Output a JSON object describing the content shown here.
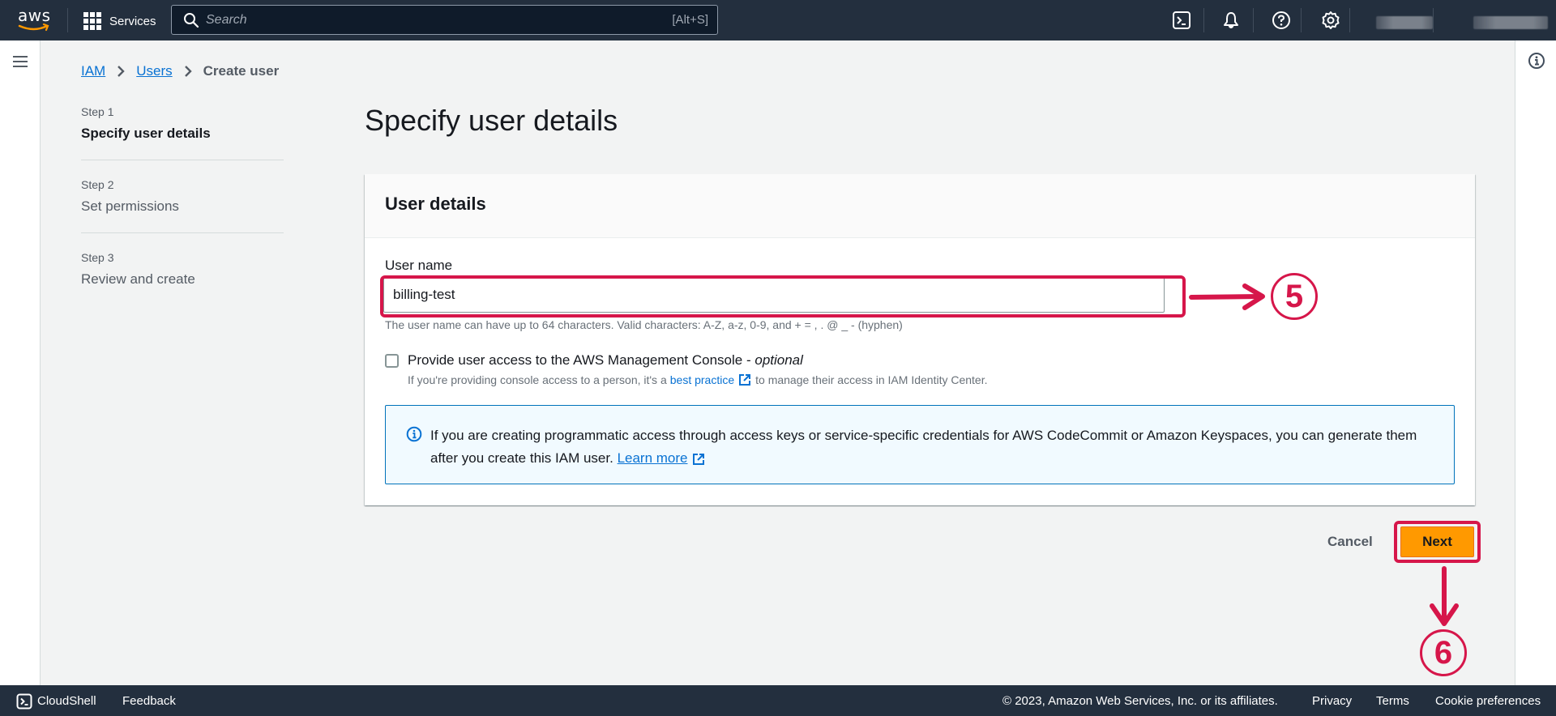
{
  "topbar": {
    "logo_text": "aws",
    "services_label": "Services",
    "search_placeholder": "Search",
    "search_shortcut": "[Alt+S]",
    "icons": [
      "cloudshell-icon",
      "bell-icon",
      "help-icon",
      "gear-icon"
    ]
  },
  "breadcrumb": {
    "items": [
      {
        "label": "IAM"
      },
      {
        "label": "Users"
      },
      {
        "label": "Create user"
      }
    ]
  },
  "steps": [
    {
      "number": "Step 1",
      "title": "Specify user details",
      "active": true
    },
    {
      "number": "Step 2",
      "title": "Set permissions",
      "active": false
    },
    {
      "number": "Step 3",
      "title": "Review and create",
      "active": false
    }
  ],
  "page_title": "Specify user details",
  "panel": {
    "header": "User details",
    "user_name_label": "User name",
    "user_name_value": "billing-test",
    "user_name_hint": "The user name can have up to 64 characters. Valid characters: A-Z, a-z, 0-9, and + = , . @ _ - (hyphen)",
    "console_access": {
      "label": "Provide user access to the AWS Management Console - ",
      "label_optional": "optional",
      "checked": false,
      "desc_before": "If you're providing console access to a person, it's a",
      "desc_link": "best practice",
      "desc_after": "to manage their access in IAM Identity Center."
    },
    "info_alert": {
      "text": "If you are creating programmatic access through access keys or service-specific credentials for AWS CodeCommit or Amazon Keyspaces, you can generate them after you create this IAM user.",
      "link": "Learn more"
    }
  },
  "actions": {
    "cancel": "Cancel",
    "next": "Next"
  },
  "annotations": {
    "step5": "5",
    "step6": "6",
    "color": "#d6164a"
  },
  "footer": {
    "cloudshell": "CloudShell",
    "feedback": "Feedback",
    "copyright": "© 2023, Amazon Web Services, Inc. or its affiliates.",
    "privacy": "Privacy",
    "terms": "Terms",
    "cookie": "Cookie preferences"
  }
}
